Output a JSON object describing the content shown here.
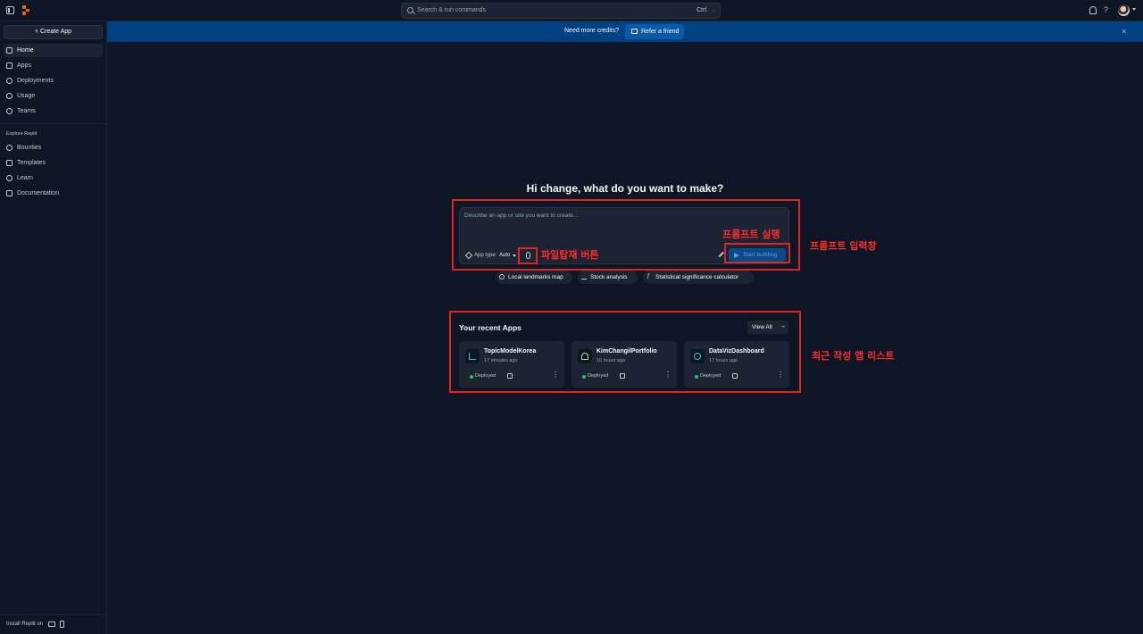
{
  "topbar": {
    "search_placeholder": "Search & run commands",
    "shortcut_key": "Ctrl",
    "shortcut_sep": ".",
    "help_label": "?"
  },
  "sidebar": {
    "create_label": "+ Create App",
    "items": [
      {
        "label": "Home",
        "icon": "home-icon"
      },
      {
        "label": "Apps",
        "icon": "folder-icon"
      },
      {
        "label": "Deployments",
        "icon": "deploy-icon"
      },
      {
        "label": "Usage",
        "icon": "usage-icon"
      },
      {
        "label": "Teams",
        "icon": "teams-icon"
      }
    ],
    "explore_label": "Explore Replit",
    "explore_items": [
      {
        "label": "Bounties",
        "icon": "bounties-icon"
      },
      {
        "label": "Templates",
        "icon": "templates-icon"
      },
      {
        "label": "Learn",
        "icon": "learn-icon"
      },
      {
        "label": "Documentation",
        "icon": "book-icon"
      }
    ],
    "install_label": "Install Replit on"
  },
  "banner": {
    "message": "Need more credits?",
    "refer_label": "Refer a friend",
    "close": "×"
  },
  "main": {
    "headline": "Hi change, what do you want to make?",
    "prompt_placeholder": "Describe an app or site you want to create...",
    "app_type_label": "App type:",
    "app_type_value": "Auto",
    "start_label": "Start building",
    "chips": [
      "Local landmarks map",
      "Stock analysis",
      "Statistical significance calculator"
    ],
    "recent_title": "Your recent Apps",
    "view_all_label": "View All",
    "view_all_arrow": "→",
    "apps": [
      {
        "name": "TopicModelKorea",
        "time": "17 minutes ago",
        "status": "Deployed"
      },
      {
        "name": "KimChangilPortfolio",
        "time": "16 hours ago",
        "status": "Deployed"
      },
      {
        "name": "DataVizDashboard",
        "time": "17 hours ago",
        "status": "Deployed"
      }
    ],
    "more_glyph": "⋮"
  },
  "annotations": {
    "attach": "파일탑재 버튼",
    "run": "프롬프트 실행",
    "input": "프롬프트 입력창",
    "recent": "최근 작성 앱 리스트"
  },
  "colors": {
    "background": "#0e1525",
    "surface": "#1c2333",
    "banner": "#004182",
    "annotation_red": "#e02424",
    "deployed_green": "#1fbd5d"
  }
}
